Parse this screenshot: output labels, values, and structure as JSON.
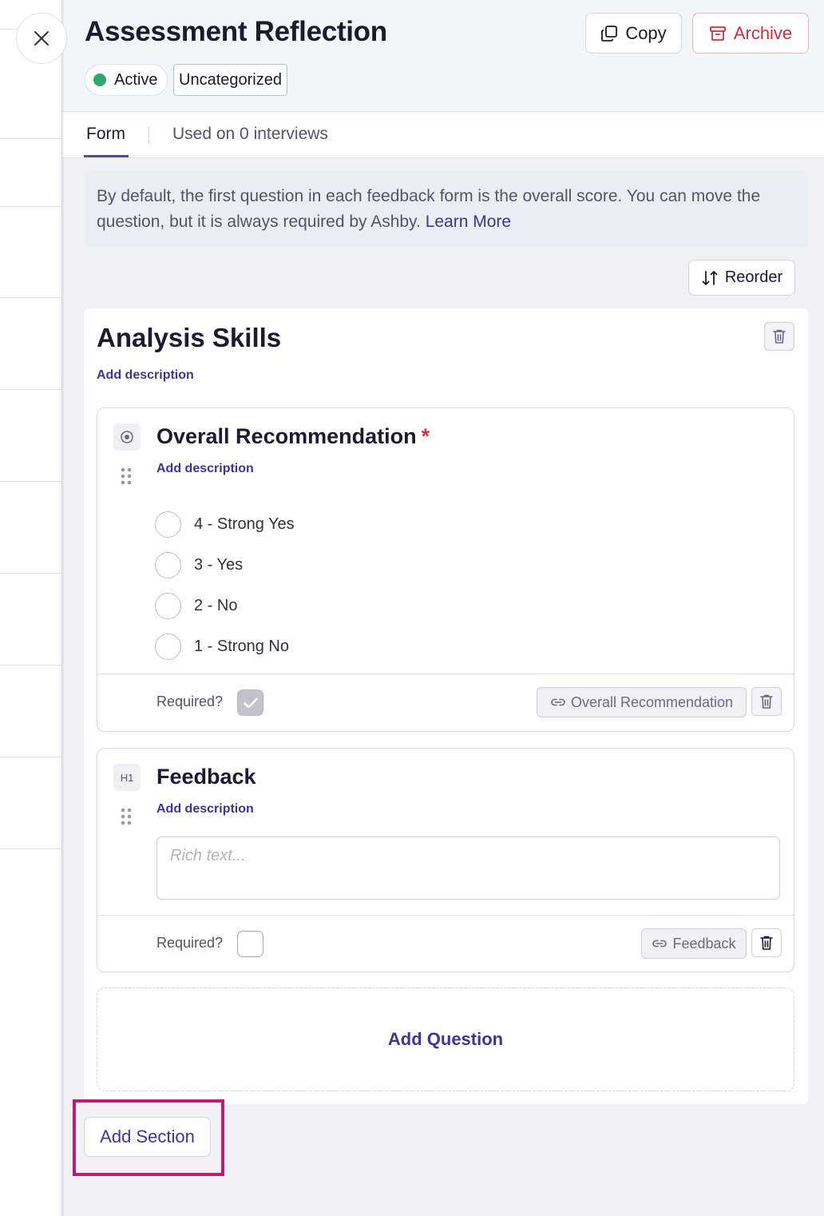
{
  "header": {
    "title": "Assessment Reflection",
    "status_label": "Active",
    "status_color": "#2fa86f",
    "category_label": "Uncategorized",
    "copy_label": "Copy",
    "archive_label": "Archive"
  },
  "tabs": [
    {
      "label": "Form",
      "active": true
    },
    {
      "label": "Used on 0 interviews",
      "active": false
    }
  ],
  "info": {
    "text": "By default, the first question in each feedback form is the overall score. You can move the question, but it is always required by Ashby.",
    "link": "Learn More"
  },
  "reorder_label": "Reorder",
  "section": {
    "title": "Analysis Skills",
    "add_description": "Add description"
  },
  "questions": [
    {
      "type_badge": "",
      "title": "Overall Recommendation",
      "required_marker": "*",
      "add_description": "Add description",
      "options": [
        "4 - Strong Yes",
        "3 - Yes",
        "2 - No",
        "1 - Strong No"
      ],
      "required_label": "Required?",
      "required": true,
      "link_label": "Overall Recommendation"
    },
    {
      "type_badge": "H1",
      "title": "Feedback",
      "add_description": "Add description",
      "placeholder": "Rich text...",
      "required_label": "Required?",
      "required": false,
      "link_label": "Feedback"
    }
  ],
  "add_question_label": "Add Question",
  "add_section_label": "Add Section",
  "colors": {
    "accent": "#3f3590",
    "danger": "#c8323d",
    "highlight": "#b91f6e"
  }
}
